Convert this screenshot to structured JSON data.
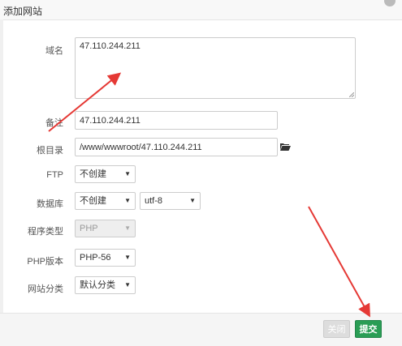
{
  "dialog": {
    "title": "添加网站"
  },
  "form": {
    "domain": {
      "label": "域名",
      "value": "47.110.244.211"
    },
    "remark": {
      "label": "备注",
      "value": "47.110.244.211"
    },
    "root": {
      "label": "根目录",
      "value": "/www/wwwroot/47.110.244.211",
      "icon": "folder-open-icon"
    },
    "ftp": {
      "label": "FTP",
      "selected": "不创建"
    },
    "database": {
      "label": "数据库",
      "selected": "不创建",
      "charset": "utf-8"
    },
    "program_type": {
      "label": "程序类型",
      "selected": "PHP"
    },
    "php_version": {
      "label": "PHP版本",
      "selected": "PHP-56"
    },
    "category": {
      "label": "网站分类",
      "selected": "默认分类"
    }
  },
  "buttons": {
    "close": "关闭",
    "submit": "提交"
  },
  "colors": {
    "submit": "#2a9d55",
    "annotation_arrow": "#e53935"
  }
}
